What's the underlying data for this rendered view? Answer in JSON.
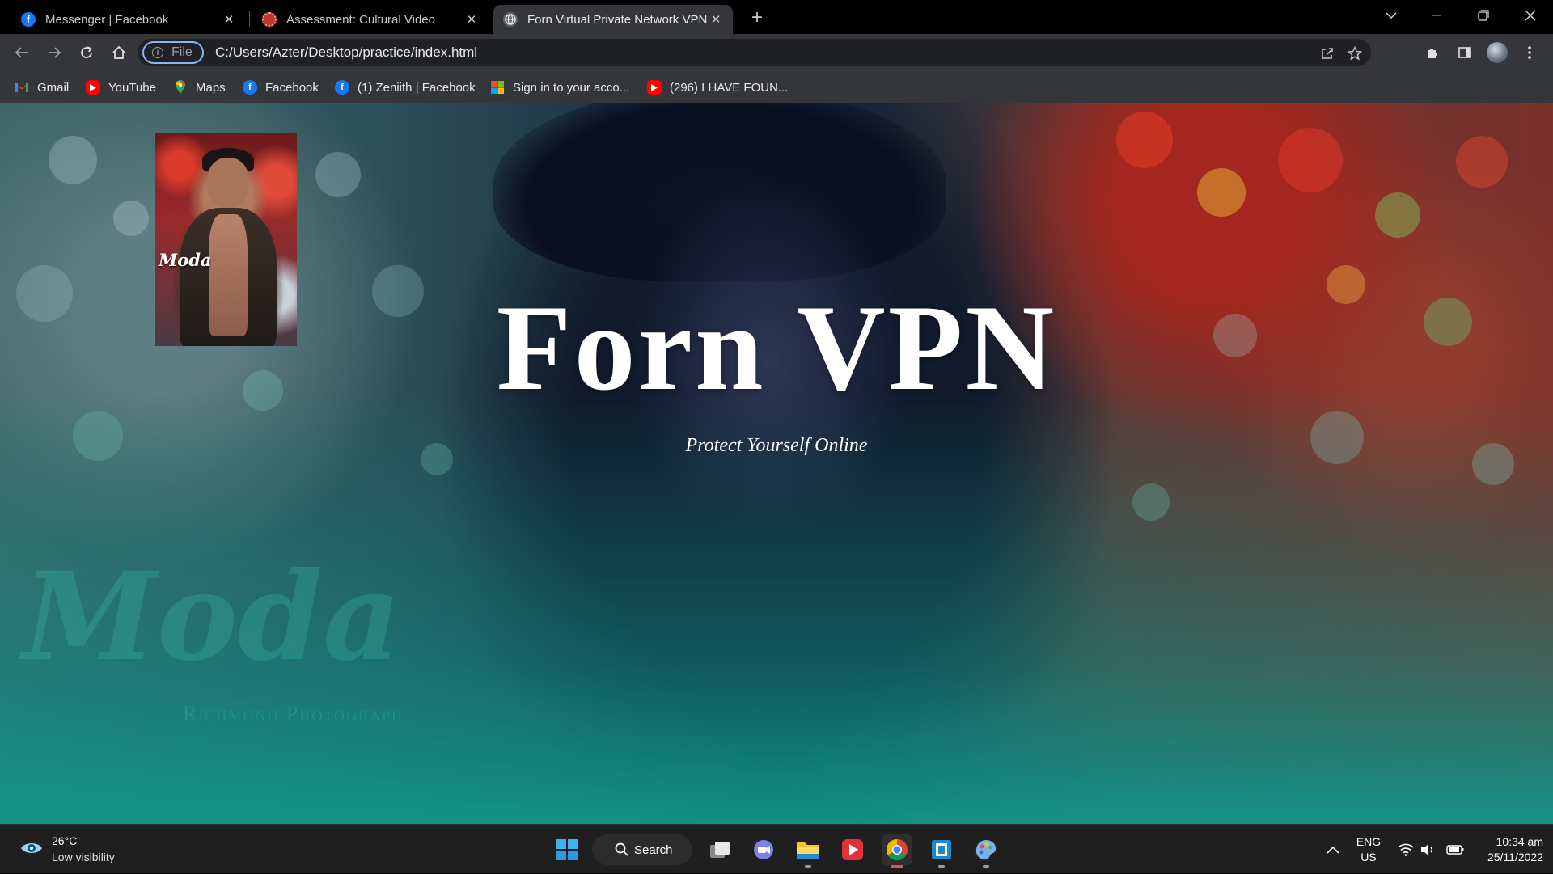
{
  "browser": {
    "tabs": [
      {
        "title": "Messenger | Facebook",
        "favicon": "facebook-icon"
      },
      {
        "title": "Assessment: Cultural Video",
        "favicon": "assessment-icon"
      },
      {
        "title": "Forn Virtual Private Network VPN",
        "favicon": "globe-icon",
        "active": true
      }
    ],
    "address": {
      "chip_label": "File",
      "url": "C:/Users/Azter/Desktop/practice/index.html"
    },
    "bookmarks": [
      {
        "label": "Gmail",
        "icon": "gmail-icon"
      },
      {
        "label": "YouTube",
        "icon": "youtube-icon"
      },
      {
        "label": "Maps",
        "icon": "maps-icon"
      },
      {
        "label": "Facebook",
        "icon": "facebook-icon"
      },
      {
        "label": "(1) Zeniith | Facebook",
        "icon": "facebook-icon"
      },
      {
        "label": "Sign in to your acco...",
        "icon": "microsoft-icon"
      },
      {
        "label": "(296) I HAVE FOUN...",
        "icon": "youtube-icon"
      }
    ]
  },
  "hero": {
    "title": "Forn VPN",
    "subtitle": "Protect Yourself Online",
    "photo_logo": "Moda",
    "watermark": "Moda",
    "watermark_sub": "Richmond Photograph"
  },
  "taskbar": {
    "weather_temp": "26°C",
    "weather_desc": "Low visibility",
    "search_label": "Search",
    "lang_top": "ENG",
    "lang_bottom": "US",
    "time": "10:34 am",
    "date": "25/11/2022"
  },
  "colors": {
    "accent_active_tab": "#35363a",
    "url_chip_border": "#8ab4f8",
    "hero_teal": "#10968a"
  }
}
